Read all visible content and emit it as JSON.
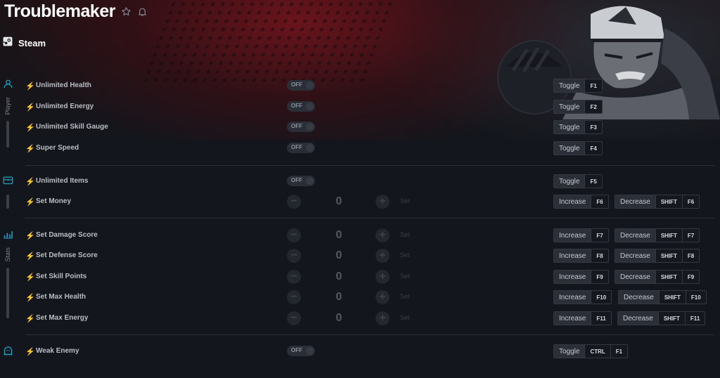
{
  "title": "Troublemaker",
  "header_icons": [
    "star-icon",
    "bell-icon"
  ],
  "platform": {
    "icon": "steam-icon",
    "label": "Steam"
  },
  "categories": [
    {
      "label": "Player",
      "icon": "person-icon"
    },
    {
      "label": "",
      "icon": "chest-icon"
    },
    {
      "label": "Stats",
      "icon": "bar-chart-icon"
    },
    {
      "label": "",
      "icon": "ghost-icon"
    }
  ],
  "toggle_off_label": "OFF",
  "set_label": "Set",
  "rows": [
    {
      "label": "Unlimited Health",
      "type": "toggle",
      "state": "OFF",
      "hotkeys": [
        {
          "action": "Toggle",
          "keys": [
            "F1"
          ]
        }
      ]
    },
    {
      "label": "Unlimited Energy",
      "type": "toggle",
      "state": "OFF",
      "hotkeys": [
        {
          "action": "Toggle",
          "keys": [
            "F2"
          ]
        }
      ]
    },
    {
      "label": "Unlimited Skill Gauge",
      "type": "toggle",
      "state": "OFF",
      "hotkeys": [
        {
          "action": "Toggle",
          "keys": [
            "F3"
          ]
        }
      ]
    },
    {
      "label": "Super Speed",
      "type": "toggle",
      "state": "OFF",
      "hotkeys": [
        {
          "action": "Toggle",
          "keys": [
            "F4"
          ]
        }
      ]
    },
    {
      "label": "Unlimited Items",
      "type": "toggle",
      "state": "OFF",
      "hotkeys": [
        {
          "action": "Toggle",
          "keys": [
            "F5"
          ]
        }
      ]
    },
    {
      "label": "Set Money",
      "type": "number",
      "value": "0",
      "hotkeys": [
        {
          "action": "Increase",
          "keys": [
            "F6"
          ]
        },
        {
          "action": "Decrease",
          "keys": [
            "SHIFT",
            "F6"
          ]
        }
      ]
    },
    {
      "label": "Set Damage Score",
      "type": "number",
      "value": "0",
      "hotkeys": [
        {
          "action": "Increase",
          "keys": [
            "F7"
          ]
        },
        {
          "action": "Decrease",
          "keys": [
            "SHIFT",
            "F7"
          ]
        }
      ]
    },
    {
      "label": "Set Defense Score",
      "type": "number",
      "value": "0",
      "hotkeys": [
        {
          "action": "Increase",
          "keys": [
            "F8"
          ]
        },
        {
          "action": "Decrease",
          "keys": [
            "SHIFT",
            "F8"
          ]
        }
      ]
    },
    {
      "label": "Set Skill Points",
      "type": "number",
      "value": "0",
      "hotkeys": [
        {
          "action": "Increase",
          "keys": [
            "F9"
          ]
        },
        {
          "action": "Decrease",
          "keys": [
            "SHIFT",
            "F9"
          ]
        }
      ]
    },
    {
      "label": "Set Max Health",
      "type": "number",
      "value": "0",
      "hotkeys": [
        {
          "action": "Increase",
          "keys": [
            "F10"
          ]
        },
        {
          "action": "Decrease",
          "keys": [
            "SHIFT",
            "F10"
          ]
        }
      ]
    },
    {
      "label": "Set Max Energy",
      "type": "number",
      "value": "0",
      "hotkeys": [
        {
          "action": "Increase",
          "keys": [
            "F11"
          ]
        },
        {
          "action": "Decrease",
          "keys": [
            "SHIFT",
            "F11"
          ]
        }
      ]
    },
    {
      "label": "Weak Enemy",
      "type": "toggle",
      "state": "OFF",
      "hotkeys": [
        {
          "action": "Toggle",
          "keys": [
            "CTRL",
            "F1"
          ]
        }
      ]
    }
  ],
  "colors": {
    "accent": "#1fa2c4",
    "background": "#13161c",
    "banner_red": "#7a141c"
  }
}
